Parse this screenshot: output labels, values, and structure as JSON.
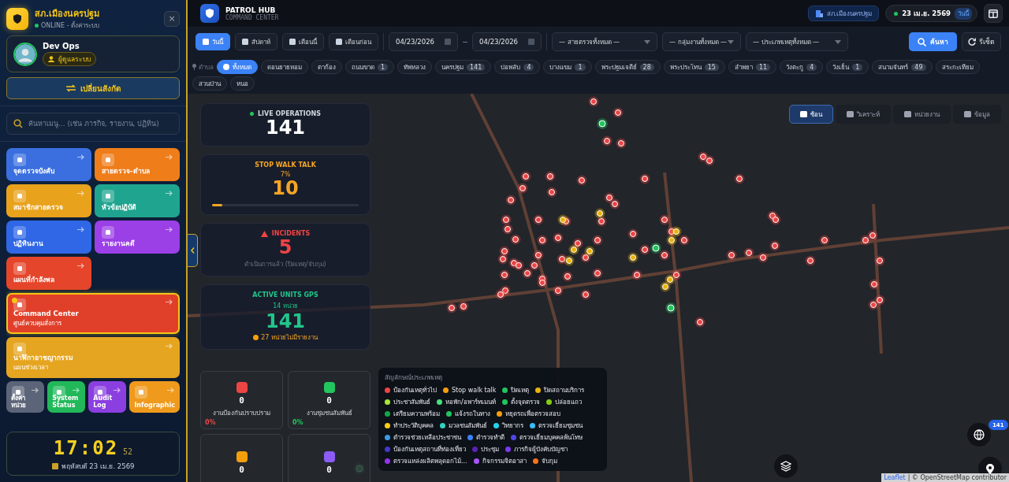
{
  "sidebar": {
    "station": "สภ.เมืองนครปฐม",
    "status": "ONLINE - ตั้งค่าระบบ",
    "close": "×",
    "user": {
      "name": "Dev Ops",
      "role": "ผู้ดูแลระบบ"
    },
    "switch_button": "เปลี่ยนสังกัด",
    "search": {
      "placeholder": "ค้นหาเมนู... (เช่น ภารกิจ, รายงาน, ปฏิทิน)"
    },
    "tiles": [
      {
        "kind": "half",
        "label": "จุดตรวจบังคับ",
        "color": "#3b6fe0",
        "selected": false
      },
      {
        "kind": "half",
        "label": "สายตรวจ-ตำบล",
        "color": "#ef7d1a",
        "selected": false
      },
      {
        "kind": "half",
        "label": "สมาชิกสายตรวจ",
        "color": "#e9a21c",
        "selected": false
      },
      {
        "kind": "half",
        "label": "หัวข้อปฏิบัติ",
        "color": "#1fa58f",
        "selected": false
      },
      {
        "kind": "half",
        "label": "ปฏิทินงาน",
        "color": "#2f67e6",
        "selected": false
      },
      {
        "kind": "half",
        "label": "รายงานคดี",
        "color": "#9b3fe6",
        "selected": false
      },
      {
        "kind": "half",
        "label": "แผนที่กำลังพล",
        "color": "#e5452a",
        "selected": false
      },
      {
        "kind": "wide",
        "label": "Command Center",
        "sublabel": "ศูนย์ควบคุมสั่งการ",
        "color": "#e0402a",
        "selected": true
      },
      {
        "kind": "wide",
        "label": "นาฬิกาอาชญากรรม",
        "sublabel": "แผนช่วงเวลา",
        "color": "#e6a520",
        "selected": false
      },
      {
        "kind": "small",
        "label": "ตั้งค่าหน่วย",
        "color": "#5b6478",
        "selected": false
      },
      {
        "kind": "small",
        "label": "System Status",
        "color": "#22b85a",
        "selected": false
      },
      {
        "kind": "small",
        "label": "Audit Log",
        "color": "#8b3fe0",
        "selected": false
      },
      {
        "kind": "small",
        "label": "Infographic",
        "color": "#ef9a1c",
        "selected": false
      }
    ],
    "clock": {
      "time": "17:02",
      "seconds": "52",
      "date": "พฤหัสบดี 23 เม.ย. 2569"
    }
  },
  "header": {
    "title": "PATROL HUB",
    "subtitle": "COMMAND CENTER",
    "station": "สภ.เมืองนครปฐม",
    "date": "23 เม.ย. 2569",
    "today": "วันนี้"
  },
  "filters": {
    "periods": [
      {
        "label": "วันนี้",
        "selected": true
      },
      {
        "label": "สัปดาห์",
        "selected": false
      },
      {
        "label": "เดือนนี้",
        "selected": false
      },
      {
        "label": "เดือนก่อน",
        "selected": false
      }
    ],
    "date_from": "04/23/2026",
    "date_to": "04/23/2026",
    "selects": [
      "— สายตรวจทั้งหมด —",
      "— กลุ่มงานทั้งหมด —",
      "— ประเภทเหตุทั้งหมด —"
    ],
    "search_button": "ค้นหา",
    "reset_button": "รีเซ็ต"
  },
  "subdistricts": {
    "label": "ตำบล",
    "chips": [
      {
        "label": "ทั้งหมด",
        "selected": true
      },
      {
        "label": "ดอนยายหอม",
        "selected": false
      },
      {
        "label": "ตาก้อง",
        "selected": false
      },
      {
        "label": "ถนนขาด",
        "count": "1",
        "selected": false
      },
      {
        "label": "ทัพหลวง",
        "selected": false
      },
      {
        "label": "นครปฐม",
        "count": "141",
        "selected": false
      },
      {
        "label": "บ่อพลับ",
        "count": "4",
        "selected": false
      },
      {
        "label": "บางแขม",
        "count": "1",
        "selected": false
      },
      {
        "label": "พระปฐมเจดีย์",
        "count": "28",
        "selected": false
      },
      {
        "label": "พระประโทน",
        "count": "15",
        "selected": false
      },
      {
        "label": "ลำพยา",
        "count": "11",
        "selected": false
      },
      {
        "label": "วังตะกู",
        "count": "4",
        "selected": false
      },
      {
        "label": "วังเย็น",
        "count": "1",
        "selected": false
      },
      {
        "label": "สนามจันทร์",
        "count": "49",
        "selected": false
      },
      {
        "label": "สระกะเทียม",
        "selected": false
      },
      {
        "label": "สวนป่าน",
        "selected": false
      },
      {
        "label": "หนอ",
        "selected": false
      }
    ]
  },
  "map": {
    "views": [
      {
        "label": "ซ้อน",
        "selected": true
      },
      {
        "label": "วิเคราะห์",
        "selected": false
      },
      {
        "label": "หน่วยงาน",
        "selected": false
      },
      {
        "label": "ข้อมูล",
        "selected": false
      }
    ],
    "stats": [
      {
        "kind": "live",
        "title": "LIVE OPERATIONS",
        "value": "141"
      },
      {
        "kind": "progress",
        "title": "STOP WALK TALK",
        "percent": "7%",
        "value": "10",
        "level": 0.07
      },
      {
        "kind": "incident",
        "title": "INCIDENTS",
        "value": "5",
        "note": "ดำเนินการแล้ว (ปิดเหตุ/จับกุม)"
      },
      {
        "kind": "units",
        "title": "ACTIVE UNITS GPS",
        "units": "14 หน่วย",
        "value": "141",
        "warning": "27 หน่วยไม่มีรายงาน"
      }
    ],
    "work_groups": [
      {
        "value": "0",
        "label": "งานป้องกันปราบปราม",
        "percent": "0%",
        "color": "#ef4444"
      },
      {
        "value": "0",
        "label": "งานชุมชนสัมพันธ์",
        "percent": "0%",
        "color": "#22c55e"
      },
      {
        "value": "0",
        "color": "#f59e0b"
      },
      {
        "value": "0",
        "color": "#8b5cf6"
      }
    ],
    "legend": {
      "title": "สัญลักษณ์ประเภทเหตุ",
      "items": [
        {
          "label": "ป้องกันเหตุทั่วไป",
          "color": "#ef4444"
        },
        {
          "label": "Stop walk talk",
          "color": "#f59e0b"
        },
        {
          "label": "ปิดเหตุ",
          "color": "#22c55e"
        },
        {
          "label": "ปิดสถานบริการ",
          "color": "#eab308"
        },
        {
          "label": "ประชาสัมพันธ์",
          "color": "#a3e635"
        },
        {
          "label": "หอพัก/อพาร์ทเมนท์",
          "color": "#4ade80"
        },
        {
          "label": "ตั้งจุดตรวจ",
          "color": "#22c55e"
        },
        {
          "label": "ปล่อยแถว",
          "color": "#84cc16"
        },
        {
          "label": "เตรียมความพร้อม",
          "color": "#16a34a"
        },
        {
          "label": "แจ้งรถในทาง",
          "color": "#22c55e"
        },
        {
          "label": "หยุดรถเพื่อตรวจสอบ",
          "color": "#f59e0b"
        },
        {
          "label": "ทำประวัติบุคคล",
          "color": "#facc15"
        },
        {
          "label": "มวลชนสัมพันธ์",
          "color": "#2dd4bf"
        },
        {
          "label": "วิทยากร",
          "color": "#22d3ee"
        },
        {
          "label": "ตรวจเยี่ยมชุมชน",
          "color": "#38bdf8"
        },
        {
          "label": "ตำรวจช่วยเหลือประชาชน",
          "color": "#3b9ae8"
        },
        {
          "label": "ตำรวจทำดี",
          "color": "#3b82f6"
        },
        {
          "label": "ตรวจเยี่ยมบุคคลพ้นโทษ",
          "color": "#4f46e5"
        },
        {
          "label": "ป้องกันเหตุสถานที่ท่องเที่ยว",
          "color": "#4338ca"
        },
        {
          "label": "ประชุม",
          "color": "#5b21b6"
        },
        {
          "label": "ภารกิจผู้บังคับบัญชา",
          "color": "#7c3aed"
        },
        {
          "label": "ตรวจแหล่งผลิตพลุดอกไม้...",
          "color": "#9333ea"
        },
        {
          "label": "กิจกรรมจิตอาสา",
          "color": "#a855f7"
        },
        {
          "label": "จับกุม",
          "color": "#f97316"
        }
      ]
    },
    "unit_badge": "141",
    "attribution_link": "Leaflet",
    "attribution": "| © OpenStreetMap contributor"
  }
}
